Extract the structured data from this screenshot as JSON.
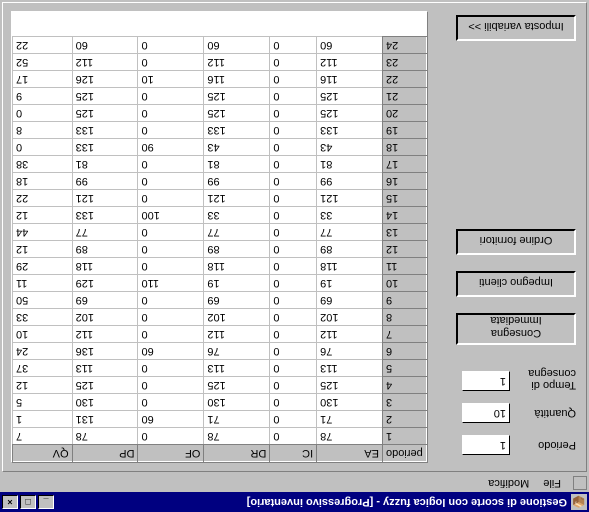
{
  "window": {
    "title": "Gestione di scorte con logica fuzzy - [Progressivo inventario]"
  },
  "menubar": {
    "file": "File",
    "modifica": "Modifica"
  },
  "form": {
    "periodo_label": "Periodo",
    "periodo_value": "1",
    "quantita_label": "Quantità",
    "quantita_value": "10",
    "tempo_label1": "Tempo di",
    "tempo_label2": "consegna",
    "tempo_value": "1"
  },
  "buttons": {
    "consegna1": "Consegna",
    "consegna2": "Immediata",
    "impegno": "Impegno clienti",
    "ordine": "Ordine fornitori",
    "imposta": "Imposta variabili >>"
  },
  "grid": {
    "columns": [
      "periodo",
      "EA",
      "IC",
      "DR",
      "OF",
      "DP",
      "QV"
    ],
    "rows": [
      {
        "periodo": "1",
        "EA": 78,
        "IC": 0,
        "DR": 78,
        "OF": 0,
        "DP": 78,
        "QV": 7
      },
      {
        "periodo": "2",
        "EA": 71,
        "IC": 0,
        "DR": 71,
        "OF": 60,
        "DP": 131,
        "QV": 1
      },
      {
        "periodo": "3",
        "EA": 130,
        "IC": 0,
        "DR": 130,
        "OF": 0,
        "DP": 130,
        "QV": 5
      },
      {
        "periodo": "4",
        "EA": 125,
        "IC": 0,
        "DR": 125,
        "OF": 0,
        "DP": 125,
        "QV": 12
      },
      {
        "periodo": "5",
        "EA": 113,
        "IC": 0,
        "DR": 113,
        "OF": 0,
        "DP": 113,
        "QV": 37
      },
      {
        "periodo": "6",
        "EA": 76,
        "IC": 0,
        "DR": 76,
        "OF": 60,
        "DP": 136,
        "QV": 24
      },
      {
        "periodo": "7",
        "EA": 112,
        "IC": 0,
        "DR": 112,
        "OF": 0,
        "DP": 112,
        "QV": 10
      },
      {
        "periodo": "8",
        "EA": 102,
        "IC": 0,
        "DR": 102,
        "OF": 0,
        "DP": 102,
        "QV": 33
      },
      {
        "periodo": "9",
        "EA": 69,
        "IC": 0,
        "DR": 69,
        "OF": 0,
        "DP": 69,
        "QV": 50
      },
      {
        "periodo": "10",
        "EA": 19,
        "IC": 0,
        "DR": 19,
        "OF": 110,
        "DP": 129,
        "QV": 11
      },
      {
        "periodo": "11",
        "EA": 118,
        "IC": 0,
        "DR": 118,
        "OF": 0,
        "DP": 118,
        "QV": 29
      },
      {
        "periodo": "12",
        "EA": 89,
        "IC": 0,
        "DR": 89,
        "OF": 0,
        "DP": 89,
        "QV": 12
      },
      {
        "periodo": "13",
        "EA": 77,
        "IC": 0,
        "DR": 77,
        "OF": 0,
        "DP": 77,
        "QV": 44
      },
      {
        "periodo": "14",
        "EA": 33,
        "IC": 0,
        "DR": 33,
        "OF": 100,
        "DP": 133,
        "QV": 12
      },
      {
        "periodo": "15",
        "EA": 121,
        "IC": 0,
        "DR": 121,
        "OF": 0,
        "DP": 121,
        "QV": 22
      },
      {
        "periodo": "16",
        "EA": 99,
        "IC": 0,
        "DR": 99,
        "OF": 0,
        "DP": 99,
        "QV": 18
      },
      {
        "periodo": "17",
        "EA": 81,
        "IC": 0,
        "DR": 81,
        "OF": 0,
        "DP": 81,
        "QV": 38
      },
      {
        "periodo": "18",
        "EA": 43,
        "IC": 0,
        "DR": 43,
        "OF": 90,
        "DP": 133,
        "QV": 0
      },
      {
        "periodo": "19",
        "EA": 133,
        "IC": 0,
        "DR": 133,
        "OF": 0,
        "DP": 133,
        "QV": 8
      },
      {
        "periodo": "20",
        "EA": 125,
        "IC": 0,
        "DR": 125,
        "OF": 0,
        "DP": 125,
        "QV": 0
      },
      {
        "periodo": "21",
        "EA": 125,
        "IC": 0,
        "DR": 125,
        "OF": 0,
        "DP": 125,
        "QV": 9
      },
      {
        "periodo": "22",
        "EA": 116,
        "IC": 0,
        "DR": 116,
        "OF": 10,
        "DP": 126,
        "QV": 17
      },
      {
        "periodo": "23",
        "EA": 112,
        "IC": 0,
        "DR": 112,
        "OF": 0,
        "DP": 112,
        "QV": 52
      },
      {
        "periodo": "24",
        "EA": 60,
        "IC": 0,
        "DR": 60,
        "OF": 0,
        "DP": 60,
        "QV": 22
      }
    ]
  },
  "chart_data": {
    "type": "table",
    "title": "Progressivo inventario",
    "columns": [
      "periodo",
      "EA",
      "IC",
      "DR",
      "OF",
      "DP",
      "QV"
    ],
    "rows": [
      [
        1,
        78,
        0,
        78,
        0,
        78,
        7
      ],
      [
        2,
        71,
        0,
        71,
        60,
        131,
        1
      ],
      [
        3,
        130,
        0,
        130,
        0,
        130,
        5
      ],
      [
        4,
        125,
        0,
        125,
        0,
        125,
        12
      ],
      [
        5,
        113,
        0,
        113,
        0,
        113,
        37
      ],
      [
        6,
        76,
        0,
        76,
        60,
        136,
        24
      ],
      [
        7,
        112,
        0,
        112,
        0,
        112,
        10
      ],
      [
        8,
        102,
        0,
        102,
        0,
        102,
        33
      ],
      [
        9,
        69,
        0,
        69,
        0,
        69,
        50
      ],
      [
        10,
        19,
        0,
        19,
        110,
        129,
        11
      ],
      [
        11,
        118,
        0,
        118,
        0,
        118,
        29
      ],
      [
        12,
        89,
        0,
        89,
        0,
        89,
        12
      ],
      [
        13,
        77,
        0,
        77,
        0,
        77,
        44
      ],
      [
        14,
        33,
        0,
        33,
        100,
        133,
        12
      ],
      [
        15,
        121,
        0,
        121,
        0,
        121,
        22
      ],
      [
        16,
        99,
        0,
        99,
        0,
        99,
        18
      ],
      [
        17,
        81,
        0,
        81,
        0,
        81,
        38
      ],
      [
        18,
        43,
        0,
        43,
        90,
        133,
        0
      ],
      [
        19,
        133,
        0,
        133,
        0,
        133,
        8
      ],
      [
        20,
        125,
        0,
        125,
        0,
        125,
        0
      ],
      [
        21,
        125,
        0,
        125,
        0,
        125,
        9
      ],
      [
        22,
        116,
        0,
        116,
        10,
        126,
        17
      ],
      [
        23,
        112,
        0,
        112,
        0,
        112,
        52
      ],
      [
        24,
        60,
        0,
        60,
        0,
        60,
        22
      ]
    ]
  }
}
